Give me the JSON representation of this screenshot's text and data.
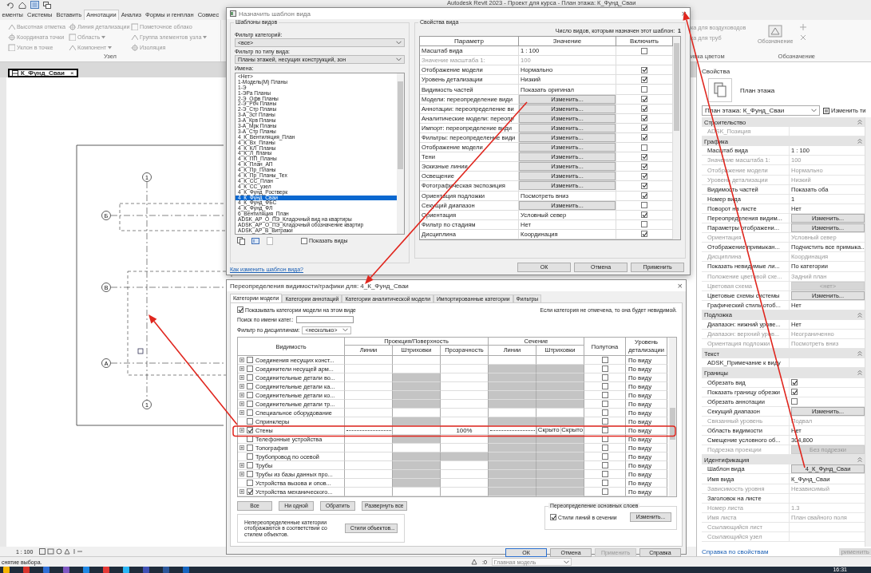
{
  "app": {
    "title": "Autodesk Revit 2023 - Проект для курса - План этажа: К_Фунд_Сваи"
  },
  "ribbon": {
    "tabs": [
      {
        "label": "ементы",
        "selected": false
      },
      {
        "label": "Системы",
        "selected": false
      },
      {
        "label": "Вставить",
        "selected": false
      },
      {
        "label": "Аннотации",
        "selected": true
      },
      {
        "label": "Анализ",
        "selected": false
      },
      {
        "label": "Формы и генплан",
        "selected": false
      },
      {
        "label": "Совмес",
        "selected": false
      }
    ],
    "columns": [
      [
        {
          "label": "Высотная отметка",
          "menu": false
        },
        {
          "label": "Координата точки",
          "menu": false
        },
        {
          "label": "Уклон  в точке",
          "menu": false
        }
      ],
      [
        {
          "label": "Линия детализации",
          "menu": false
        },
        {
          "label": "Область",
          "menu": true
        },
        {
          "label": "Компонент",
          "menu": true
        }
      ],
      [
        {
          "label": "Пометочное облако",
          "menu": false
        },
        {
          "label": "Группа элементов узла",
          "menu": true
        },
        {
          "label": "Изоляция",
          "menu": false
        }
      ]
    ],
    "panel_label": "Узел",
    "right_items": [
      "ка для воздуховодов",
      "ка для труб"
    ],
    "right_label": "ивка цветом",
    "symbol_button": "Обозначение",
    "symbol_label": "Обозначение"
  },
  "view_tab": {
    "label": "К_Фунд_Сваи",
    "close": "×"
  },
  "canvas": {
    "grid_labels": [
      "1",
      "Б",
      "В",
      "А",
      "1"
    ]
  },
  "properties": {
    "title": "Свойства",
    "type": "План этажа",
    "instance": "План этажа: К_Фунд_Сваи",
    "edit_type": "Изменить ти",
    "rows": [
      {
        "kind": "group",
        "name": "Строительство"
      },
      {
        "kind": "text",
        "name": "ADSK_Позиция",
        "disabled": true
      },
      {
        "kind": "group",
        "name": "Графика"
      },
      {
        "kind": "text",
        "name": "Масштаб вида",
        "value": "1 : 100",
        "disabled": false
      },
      {
        "kind": "text",
        "name": "Значение масштаба    1:",
        "value": "100",
        "disabled": true
      },
      {
        "kind": "text",
        "name": "Отображение модели",
        "value": "Нормально",
        "disabled": true
      },
      {
        "kind": "text",
        "name": "Уровень детализации",
        "value": "Низкий",
        "disabled": true
      },
      {
        "kind": "text",
        "name": "Видимость частей",
        "value": "Показать оба",
        "disabled": false
      },
      {
        "kind": "text",
        "name": "Номер вида",
        "value": "1",
        "disabled": false
      },
      {
        "kind": "text",
        "name": "Поворот на листе",
        "value": "Нет",
        "disabled": false
      },
      {
        "kind": "button",
        "name": "Переопределения видим...",
        "value": "Изменить...",
        "disabled": false
      },
      {
        "kind": "button",
        "name": "Параметры отображени...",
        "value": "Изменить...",
        "disabled": false
      },
      {
        "kind": "text",
        "name": "Ориентация",
        "value": "Условный север",
        "disabled": true
      },
      {
        "kind": "text",
        "name": "Отображение примыкан...",
        "value": "Подчистить все примыка...",
        "disabled": false
      },
      {
        "kind": "text",
        "name": "Дисциплина",
        "value": "Координация",
        "disabled": true
      },
      {
        "kind": "text",
        "name": "Показать невидимые ли...",
        "value": "По категории",
        "disabled": false
      },
      {
        "kind": "text",
        "name": "Положение цветовой схе...",
        "value": "Задний план",
        "disabled": true
      },
      {
        "kind": "button",
        "name": "Цветовая схема",
        "value": "<нет>",
        "disabled": true
      },
      {
        "kind": "button",
        "name": "Цветовые схемы системы",
        "value": "Изменить...",
        "disabled": false
      },
      {
        "kind": "text",
        "name": "Графический стиль отоб...",
        "value": "Нет",
        "disabled": false
      },
      {
        "kind": "group",
        "name": "Подложка"
      },
      {
        "kind": "text",
        "name": "Диапазон: нижний урове...",
        "value": "Нет",
        "disabled": false
      },
      {
        "kind": "text",
        "name": "Диапазон: верхний уров...",
        "value": "Неограниченно",
        "disabled": true
      },
      {
        "kind": "text",
        "name": "Ориентация подложки",
        "value": "Посмотреть вниз",
        "disabled": true
      },
      {
        "kind": "group",
        "name": "Текст"
      },
      {
        "kind": "text",
        "name": "ADSK_Примечание к виду",
        "disabled": false
      },
      {
        "kind": "group",
        "name": "Границы"
      },
      {
        "kind": "check",
        "name": "Обрезать вид",
        "checked": true,
        "disabled": false
      },
      {
        "kind": "check",
        "name": "Показать границу обрезки",
        "checked": true,
        "disabled": false
      },
      {
        "kind": "check",
        "name": "Обрезать аннотации",
        "checked": false,
        "disabled": false
      },
      {
        "kind": "button",
        "name": "Секущий диапазон",
        "value": "Изменить...",
        "disabled": false
      },
      {
        "kind": "text",
        "name": "Связанный уровень",
        "value": "Подвал",
        "disabled": true
      },
      {
        "kind": "text",
        "name": "Область видимости",
        "value": "Нет",
        "disabled": false
      },
      {
        "kind": "text",
        "name": "Смещение условного об...",
        "value": "304,800",
        "disabled": false
      },
      {
        "kind": "button",
        "name": "Подрезка проекции",
        "value": "Без подрезки",
        "disabled": true
      },
      {
        "kind": "group",
        "name": "Идентификация"
      },
      {
        "kind": "button",
        "name": "Шаблон вида",
        "value": "4_К_Фунд_Сваи",
        "disabled": false
      },
      {
        "kind": "text",
        "name": "Имя вида",
        "value": "К_Фунд_Сваи",
        "disabled": false
      },
      {
        "kind": "text",
        "name": "Зависимость уровня",
        "value": "Независимый",
        "disabled": true
      },
      {
        "kind": "text",
        "name": "Заголовок на листе",
        "disabled": false
      },
      {
        "kind": "text",
        "name": "Номер листа",
        "value": "1.3",
        "disabled": true
      },
      {
        "kind": "text",
        "name": "Имя листа",
        "value": "План свайного поля",
        "disabled": true
      },
      {
        "kind": "text",
        "name": "Ссылающийся лист",
        "disabled": true
      },
      {
        "kind": "text",
        "name": "Ссылающийся узел",
        "disabled": true
      }
    ],
    "help_link": "Справка по свойствам",
    "apply": "рименить"
  },
  "status_bar": {
    "scale": "1 : 100",
    "message": "снятие выбора.",
    "workset": ":0",
    "model": "Главная модель"
  },
  "taskbar": {
    "time": "16:31"
  },
  "assign_dialog": {
    "title": "Назначить шаблон вида",
    "close": "×",
    "group": "Шаблоны видов",
    "category_label": "Фильтр категорий:",
    "category_value": "<все>",
    "type_label": "Фильтр по типу вида:",
    "type_value": "Планы этажей, несущих конструкций, зон",
    "names_label": "Имена:",
    "names": [
      {
        "label": "<Нет>",
        "selected": false
      },
      {
        "label": "1-Модель(М) Планы",
        "selected": false
      },
      {
        "label": "1-Э",
        "selected": false
      },
      {
        "label": "1-ЭРа Планы",
        "selected": false
      },
      {
        "label": "2-Э_Офв Планы",
        "selected": false
      },
      {
        "label": "2-Э_Рбч Планы",
        "selected": false
      },
      {
        "label": "2-Э_Стр Планы",
        "selected": false
      },
      {
        "label": "3-А_Зст Планы",
        "selected": false
      },
      {
        "label": "3-А_Крв Планы",
        "selected": false
      },
      {
        "label": "3-А_Мрк Планы",
        "selected": false
      },
      {
        "label": "3-А_Стр Планы",
        "selected": false
      },
      {
        "label": "4_К_Вентиляция_План",
        "selected": false
      },
      {
        "label": "4_К_Вх_Планы",
        "selected": false
      },
      {
        "label": "4_К_КЛ_Планы",
        "selected": false
      },
      {
        "label": "4_К_Л_планы",
        "selected": false
      },
      {
        "label": "4_К_ПП_Планы",
        "selected": false
      },
      {
        "label": "4_К_План_АП",
        "selected": false
      },
      {
        "label": "4_К_Пр_Планы",
        "selected": false
      },
      {
        "label": "4_К_Пр_Планы_Тех",
        "selected": false
      },
      {
        "label": "4_К_СС_План",
        "selected": false
      },
      {
        "label": "4_К_СС_узел",
        "selected": false
      },
      {
        "label": "4_К_Фунд_Ростверк",
        "selected": false
      },
      {
        "label": "4_К_Фунд_Сваи",
        "selected": true
      },
      {
        "label": "4_К_Фунд_ФБС",
        "selected": false
      },
      {
        "label": "4_К_Фунд_ФЛ",
        "selected": false
      },
      {
        "label": "6_Вентиляция_План",
        "selected": false
      },
      {
        "label": "ADSK_АР_О_ПЭ_Кладочный вид на квартиры",
        "selected": false
      },
      {
        "label": "ADSK_АР_О_ПЭ_Кладочный обозначение квартир",
        "selected": false
      },
      {
        "label": "ADSK_АР_В_Витражи",
        "selected": false
      }
    ],
    "show_views": {
      "label": "Показать виды",
      "checked": false
    },
    "help_link": "Как изменить шаблон вида?",
    "props_group": "Свойства вида",
    "count_label": "Число видов, которым назначен этот шаблон:",
    "count": "1",
    "columns": [
      "Параметр",
      "Значение",
      "Включить"
    ],
    "params": [
      {
        "name": "Масштаб вида",
        "kind": "text",
        "value": "1 : 100",
        "include": false,
        "disabled": false
      },
      {
        "name": "Значение масштаба    1:",
        "kind": "text",
        "value": "100",
        "disabled": true
      },
      {
        "name": "Отображение модели",
        "kind": "text",
        "value": "Нормально",
        "include": true,
        "disabled": false
      },
      {
        "name": "Уровень детализации",
        "kind": "text",
        "value": "Низкий",
        "include": true,
        "disabled": false
      },
      {
        "name": "Видимость частей",
        "kind": "text",
        "value": "Показать оригинал",
        "include": false,
        "disabled": false
      },
      {
        "name": "Модели: переопределение види",
        "kind": "button",
        "value": "Изменить...",
        "include": true,
        "disabled": false
      },
      {
        "name": "Аннотации: переопределение ви",
        "kind": "button",
        "value": "Изменить...",
        "include": true,
        "disabled": false
      },
      {
        "name": "Аналитические модели: перeопр",
        "kind": "button",
        "value": "Изменить...",
        "include": true,
        "disabled": false
      },
      {
        "name": "Импорт: переопределение види",
        "kind": "button",
        "value": "Изменить...",
        "include": true,
        "disabled": false
      },
      {
        "name": "Фильтры: переопределение види",
        "kind": "button",
        "value": "Изменить...",
        "include": true,
        "disabled": false
      },
      {
        "name": "Отображение модели",
        "kind": "button",
        "value": "Изменить...",
        "include": false,
        "disabled": false
      },
      {
        "name": "Тени",
        "kind": "button",
        "value": "Изменить...",
        "include": true,
        "disabled": false
      },
      {
        "name": "Эскизные линии",
        "kind": "button",
        "value": "Изменить...",
        "include": true,
        "disabled": false
      },
      {
        "name": "Освещение",
        "kind": "button",
        "value": "Изменить...",
        "include": true,
        "disabled": false
      },
      {
        "name": "Фотографическая экспозиция",
        "kind": "button",
        "value": "Изменить...",
        "include": true,
        "disabled": false
      },
      {
        "name": "Ориентация подложки",
        "kind": "text",
        "value": "Посмотреть вниз",
        "include": true,
        "disabled": false
      },
      {
        "name": "Секущий диапазон",
        "kind": "button",
        "value": "Изменить...",
        "include": false,
        "disabled": false
      },
      {
        "name": "Ориентация",
        "kind": "text",
        "value": "Условный север",
        "include": true,
        "disabled": false
      },
      {
        "name": "Фильтр по стадиям",
        "kind": "text",
        "value": "Нет",
        "include": false,
        "disabled": false
      },
      {
        "name": "Дисциплина",
        "kind": "text",
        "value": "Координация",
        "include": true,
        "disabled": false
      }
    ],
    "buttons": [
      "ОК",
      "Отмена",
      "Применить"
    ]
  },
  "vg_dialog": {
    "title": "Переопределения видимости/графики для: 4_К_Фунд_Сваи",
    "close": "×",
    "tabs": [
      {
        "label": "Категории модели",
        "selected": true
      },
      {
        "label": "Категории аннотаций",
        "selected": false
      },
      {
        "label": "Категории аналитической модели",
        "selected": false
      },
      {
        "label": "Импортированные категории",
        "selected": false
      },
      {
        "label": "Фильтры",
        "selected": false
      }
    ],
    "show_categories": {
      "label": "Показывать категории модели на этом виде",
      "checked": true
    },
    "note": "Если категория не отмечена, то она будет невидимой.",
    "search_label": "Поиск по имени катег.:",
    "discipline_label": "Фильтр по дисциплинам:",
    "discipline_value": "<несколько>",
    "headers": {
      "visibility": "Видимость",
      "projection": "Проекция/Поверхность",
      "cut": "Сечение",
      "halftone": "Полутона",
      "detail": "Уровень детализации",
      "lines": "Линии",
      "patterns": "Штриховки",
      "transparency": "Прозрачность",
      "cut_lines": "Линии",
      "cut_patterns": "Штриховки"
    },
    "rows": [
      {
        "name": "Соединения несущих конст...",
        "expandable": true,
        "visible": false,
        "shaded": [
          false,
          false,
          false,
          false,
          false
        ],
        "halftone": false,
        "detail": "По виду"
      },
      {
        "name": "Соединители несущей арм...",
        "expandable": true,
        "visible": false,
        "shaded": [
          false,
          false,
          false,
          true,
          true
        ],
        "halftone": false,
        "detail": "По виду"
      },
      {
        "name": "Соединительные детали во...",
        "expandable": true,
        "visible": false,
        "shaded": [
          false,
          true,
          false,
          true,
          true
        ],
        "halftone": false,
        "detail": "По виду"
      },
      {
        "name": "Соединительные детали ка...",
        "expandable": true,
        "visible": false,
        "shaded": [
          false,
          true,
          false,
          true,
          true
        ],
        "halftone": false,
        "detail": "По виду"
      },
      {
        "name": "Соединительные детали ко...",
        "expandable": true,
        "visible": false,
        "shaded": [
          false,
          true,
          false,
          true,
          true
        ],
        "halftone": false,
        "detail": "По виду"
      },
      {
        "name": "Соединительные детали тр...",
        "expandable": true,
        "visible": false,
        "shaded": [
          false,
          true,
          false,
          true,
          true
        ],
        "halftone": false,
        "detail": "По виду"
      },
      {
        "name": "Специальное оборудование",
        "expandable": true,
        "visible": false,
        "shaded": [
          false,
          false,
          false,
          false,
          false
        ],
        "halftone": false,
        "detail": "По виду"
      },
      {
        "name": "Спринклеры",
        "expandable": false,
        "visible": false,
        "shaded": [
          false,
          true,
          false,
          true,
          true
        ],
        "halftone": false,
        "detail": "По виду"
      },
      {
        "name": "Стены",
        "expandable": true,
        "visible": true,
        "shaded": [
          false,
          false,
          false,
          false,
          false
        ],
        "lines_overridden": true,
        "transparency": "100%",
        "cut_lines_overridden": true,
        "cut_patterns": [
          "Скрыто",
          "Скрыто"
        ],
        "halftone": false,
        "detail": "По виду"
      },
      {
        "name": "Телефонные устройства",
        "expandable": false,
        "visible": false,
        "shaded": [
          false,
          true,
          false,
          true,
          true
        ],
        "halftone": false,
        "detail": "По виду"
      },
      {
        "name": "Топография",
        "expandable": true,
        "visible": false,
        "shaded": [
          false,
          false,
          false,
          true,
          true
        ],
        "halftone": false,
        "detail": "По виду"
      },
      {
        "name": "Трубопровод по осевой",
        "expandable": false,
        "visible": false,
        "shaded": [
          false,
          true,
          true,
          true,
          true
        ],
        "halftone": false,
        "detail": "По виду"
      },
      {
        "name": "Трубы",
        "expandable": true,
        "visible": false,
        "shaded": [
          false,
          true,
          false,
          true,
          true
        ],
        "halftone": false,
        "detail": "По виду"
      },
      {
        "name": "Трубы из базы данных про...",
        "expandable": true,
        "visible": false,
        "shaded": [
          false,
          true,
          false,
          true,
          true
        ],
        "halftone": false,
        "detail": "По виду"
      },
      {
        "name": "Устройства вызова и опов...",
        "expandable": false,
        "visible": false,
        "shaded": [
          false,
          true,
          false,
          true,
          true
        ],
        "halftone": false,
        "detail": "По виду"
      },
      {
        "name": "Устройства механического...",
        "expandable": true,
        "visible": true,
        "shaded": [
          false,
          false,
          false,
          true,
          true
        ],
        "halftone": false,
        "detail": "По виду"
      }
    ],
    "row_buttons": [
      "Все",
      "Ни одной",
      "Обратить",
      "Развернуть все"
    ],
    "info": "Непереопределенные категории отображаются в соответствии со стилем объектов.",
    "styles_button": "Стили объектов...",
    "layers_group": "Переопределение основных слоев",
    "cut_styles": {
      "label": "Стили линий в сечении",
      "checked": true
    },
    "layers_button": "Изменить...",
    "buttons": [
      {
        "label": "ОК",
        "disabled": false,
        "default": true
      },
      {
        "label": "Отмена",
        "disabled": false,
        "default": false
      },
      {
        "label": "Применить",
        "disabled": true,
        "default": false
      },
      {
        "label": "Справка",
        "disabled": false,
        "default": false
      }
    ]
  }
}
